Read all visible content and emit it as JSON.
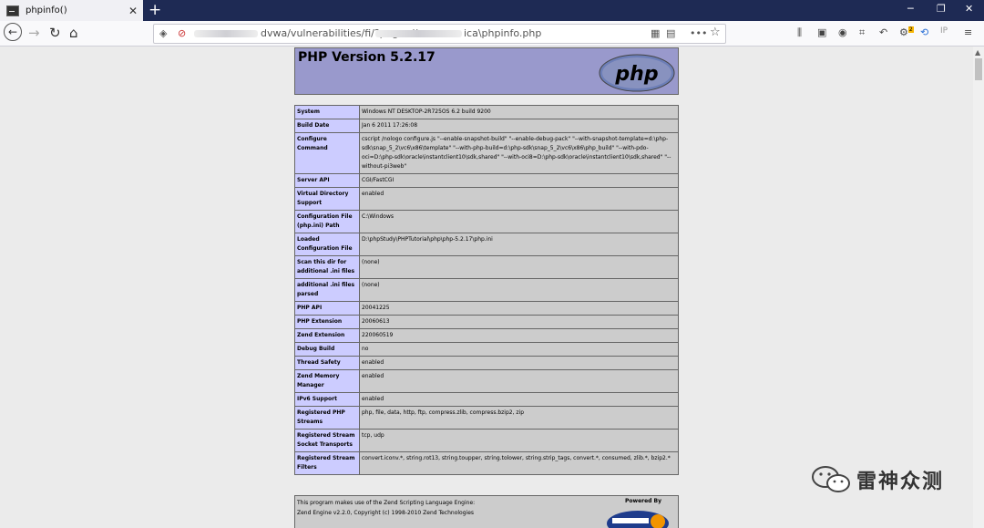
{
  "browser": {
    "tab_title": "phpinfo()",
    "tab_close": "✕",
    "new_tab": "+",
    "url_segment1": "dvwa/vulnerabilities/fi/?page=\\\\",
    "url_segment2": "ica\\phpinfo.php",
    "win_min": "─",
    "win_max": "❐",
    "win_close": "✕",
    "toolbar_icons": [
      "library-icon",
      "sidebar-icon",
      "account-icon",
      "crop-icon",
      "undo-icon",
      "addon-icon",
      "refresh-icon",
      "ip-icon"
    ],
    "addon_badge": "2",
    "ip_label": "IP",
    "menu_dots": "•••",
    "bookmark_star": "☆"
  },
  "php": {
    "version_title": "PHP Version 5.2.17",
    "logo_text": "php",
    "rows": [
      {
        "key": "System",
        "value": "Windows NT DESKTOP-2R725OS 6.2 build 9200"
      },
      {
        "key": "Build Date",
        "value": "Jan 6 2011 17:26:08"
      },
      {
        "key": "Configure Command",
        "value": "cscript /nologo configure.js \"--enable-snapshot-build\" \"--enable-debug-pack\" \"--with-snapshot-template=d:\\php-sdk\\snap_5_2\\vc6\\x86\\template\" \"--with-php-build=d:\\php-sdk\\snap_5_2\\vc6\\x86\\php_build\" \"--with-pdo-oci=D:\\php-sdk\\oracle\\instantclient10\\sdk,shared\" \"--with-oci8=D:\\php-sdk\\oracle\\instantclient10\\sdk,shared\" \"--without-pi3web\""
      },
      {
        "key": "Server API",
        "value": "CGI/FastCGI"
      },
      {
        "key": "Virtual Directory Support",
        "value": "enabled"
      },
      {
        "key": "Configuration File (php.ini) Path",
        "value": "C:\\Windows"
      },
      {
        "key": "Loaded Configuration File",
        "value": "D:\\phpStudy\\PHPTutorial\\php\\php-5.2.17\\php.ini"
      },
      {
        "key": "Scan this dir for additional .ini files",
        "value": "(none)"
      },
      {
        "key": "additional .ini files parsed",
        "value": "(none)"
      },
      {
        "key": "PHP API",
        "value": "20041225"
      },
      {
        "key": "PHP Extension",
        "value": "20060613"
      },
      {
        "key": "Zend Extension",
        "value": "220060519"
      },
      {
        "key": "Debug Build",
        "value": "no"
      },
      {
        "key": "Thread Safety",
        "value": "enabled"
      },
      {
        "key": "Zend Memory Manager",
        "value": "enabled"
      },
      {
        "key": "IPv6 Support",
        "value": "enabled"
      },
      {
        "key": "Registered PHP Streams",
        "value": "php, file, data, http, ftp, compress.zlib, compress.bzip2, zip"
      },
      {
        "key": "Registered Stream Socket Transports",
        "value": "tcp, udp"
      },
      {
        "key": "Registered Stream Filters",
        "value": "convert.iconv.*, string.rot13, string.toupper, string.tolower, string.strip_tags, convert.*, consumed, zlib.*, bzip2.*"
      }
    ],
    "footer_line1": "This program makes use of the Zend Scripting Language Engine:",
    "footer_line2": "Zend Engine v2.2.0, Copyright (c) 1998-2010 Zend Technologies",
    "powered_by": "Powered By"
  },
  "watermark": {
    "text": "雷神众测"
  },
  "colors": {
    "tabbar": "#1e2a54",
    "php_header": "#9999cc",
    "php_key": "#ccccff",
    "php_value": "#cccccc"
  }
}
